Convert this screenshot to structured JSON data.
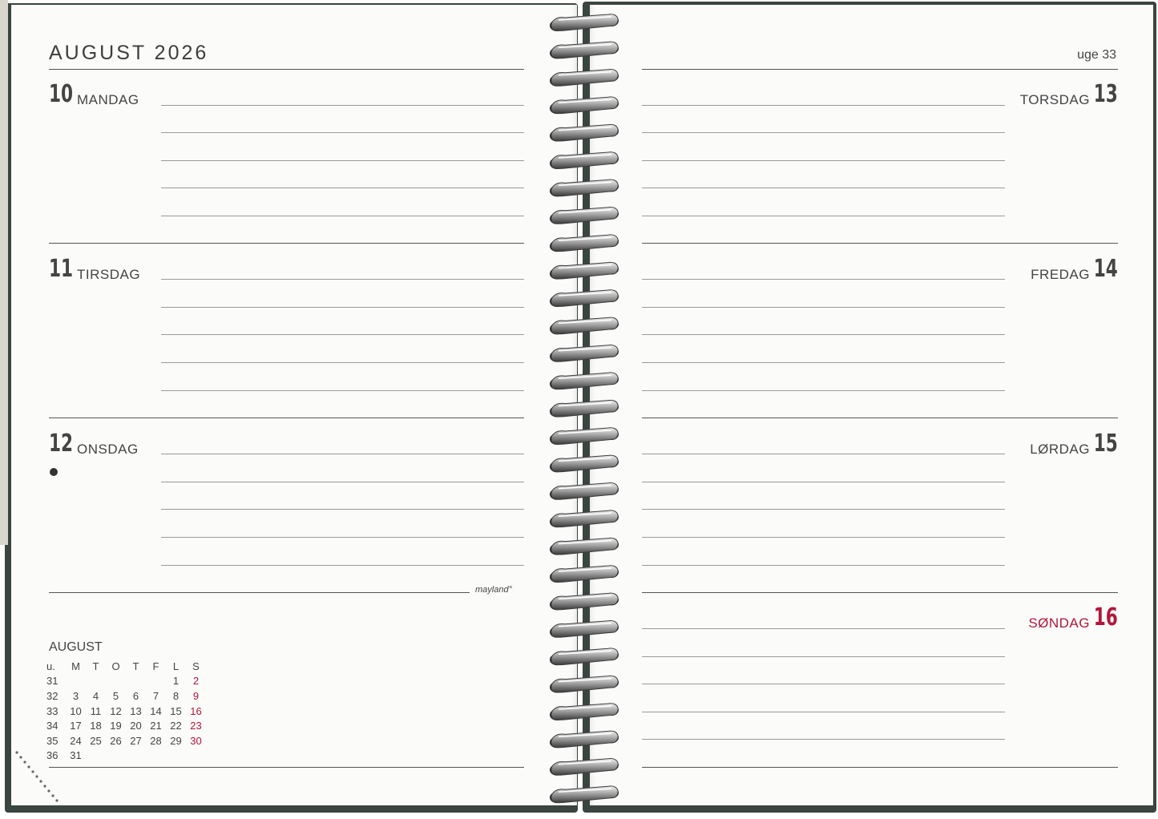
{
  "left_page": {
    "title": "AUGUST 2026",
    "days": [
      {
        "num": "10",
        "name": "MANDAG"
      },
      {
        "num": "11",
        "name": "TIRSDAG"
      },
      {
        "num": "12",
        "name": "ONSDAG"
      }
    ],
    "brand": "mayland°",
    "mini_calendar": {
      "title": "AUGUST",
      "headers": [
        "u.",
        "M",
        "T",
        "O",
        "T",
        "F",
        "L",
        "S"
      ],
      "rows": [
        [
          "31",
          "",
          "",
          "",
          "",
          "",
          "1",
          "2"
        ],
        [
          "32",
          "3",
          "4",
          "5",
          "6",
          "7",
          "8",
          "9"
        ],
        [
          "33",
          "10",
          "11",
          "12",
          "13",
          "14",
          "15",
          "16"
        ],
        [
          "34",
          "17",
          "18",
          "19",
          "20",
          "21",
          "22",
          "23"
        ],
        [
          "35",
          "24",
          "25",
          "26",
          "27",
          "28",
          "29",
          "30"
        ],
        [
          "36",
          "31",
          "",
          "",
          "",
          "",
          "",
          ""
        ]
      ]
    }
  },
  "right_page": {
    "week": "uge 33",
    "days": [
      {
        "num": "13",
        "name": "TORSDAG"
      },
      {
        "num": "14",
        "name": "FREDAG"
      },
      {
        "num": "15",
        "name": "LØRDAG"
      },
      {
        "num": "16",
        "name": "SØNDAG"
      }
    ]
  },
  "colors": {
    "cover": "#3a453f",
    "paper": "#fbfbfa",
    "sunday_red": "#b2163a",
    "ink": "#444444"
  },
  "icons": {
    "moon_phase": "new-moon-dot-icon",
    "spiral": "spiral-binding-icon"
  }
}
